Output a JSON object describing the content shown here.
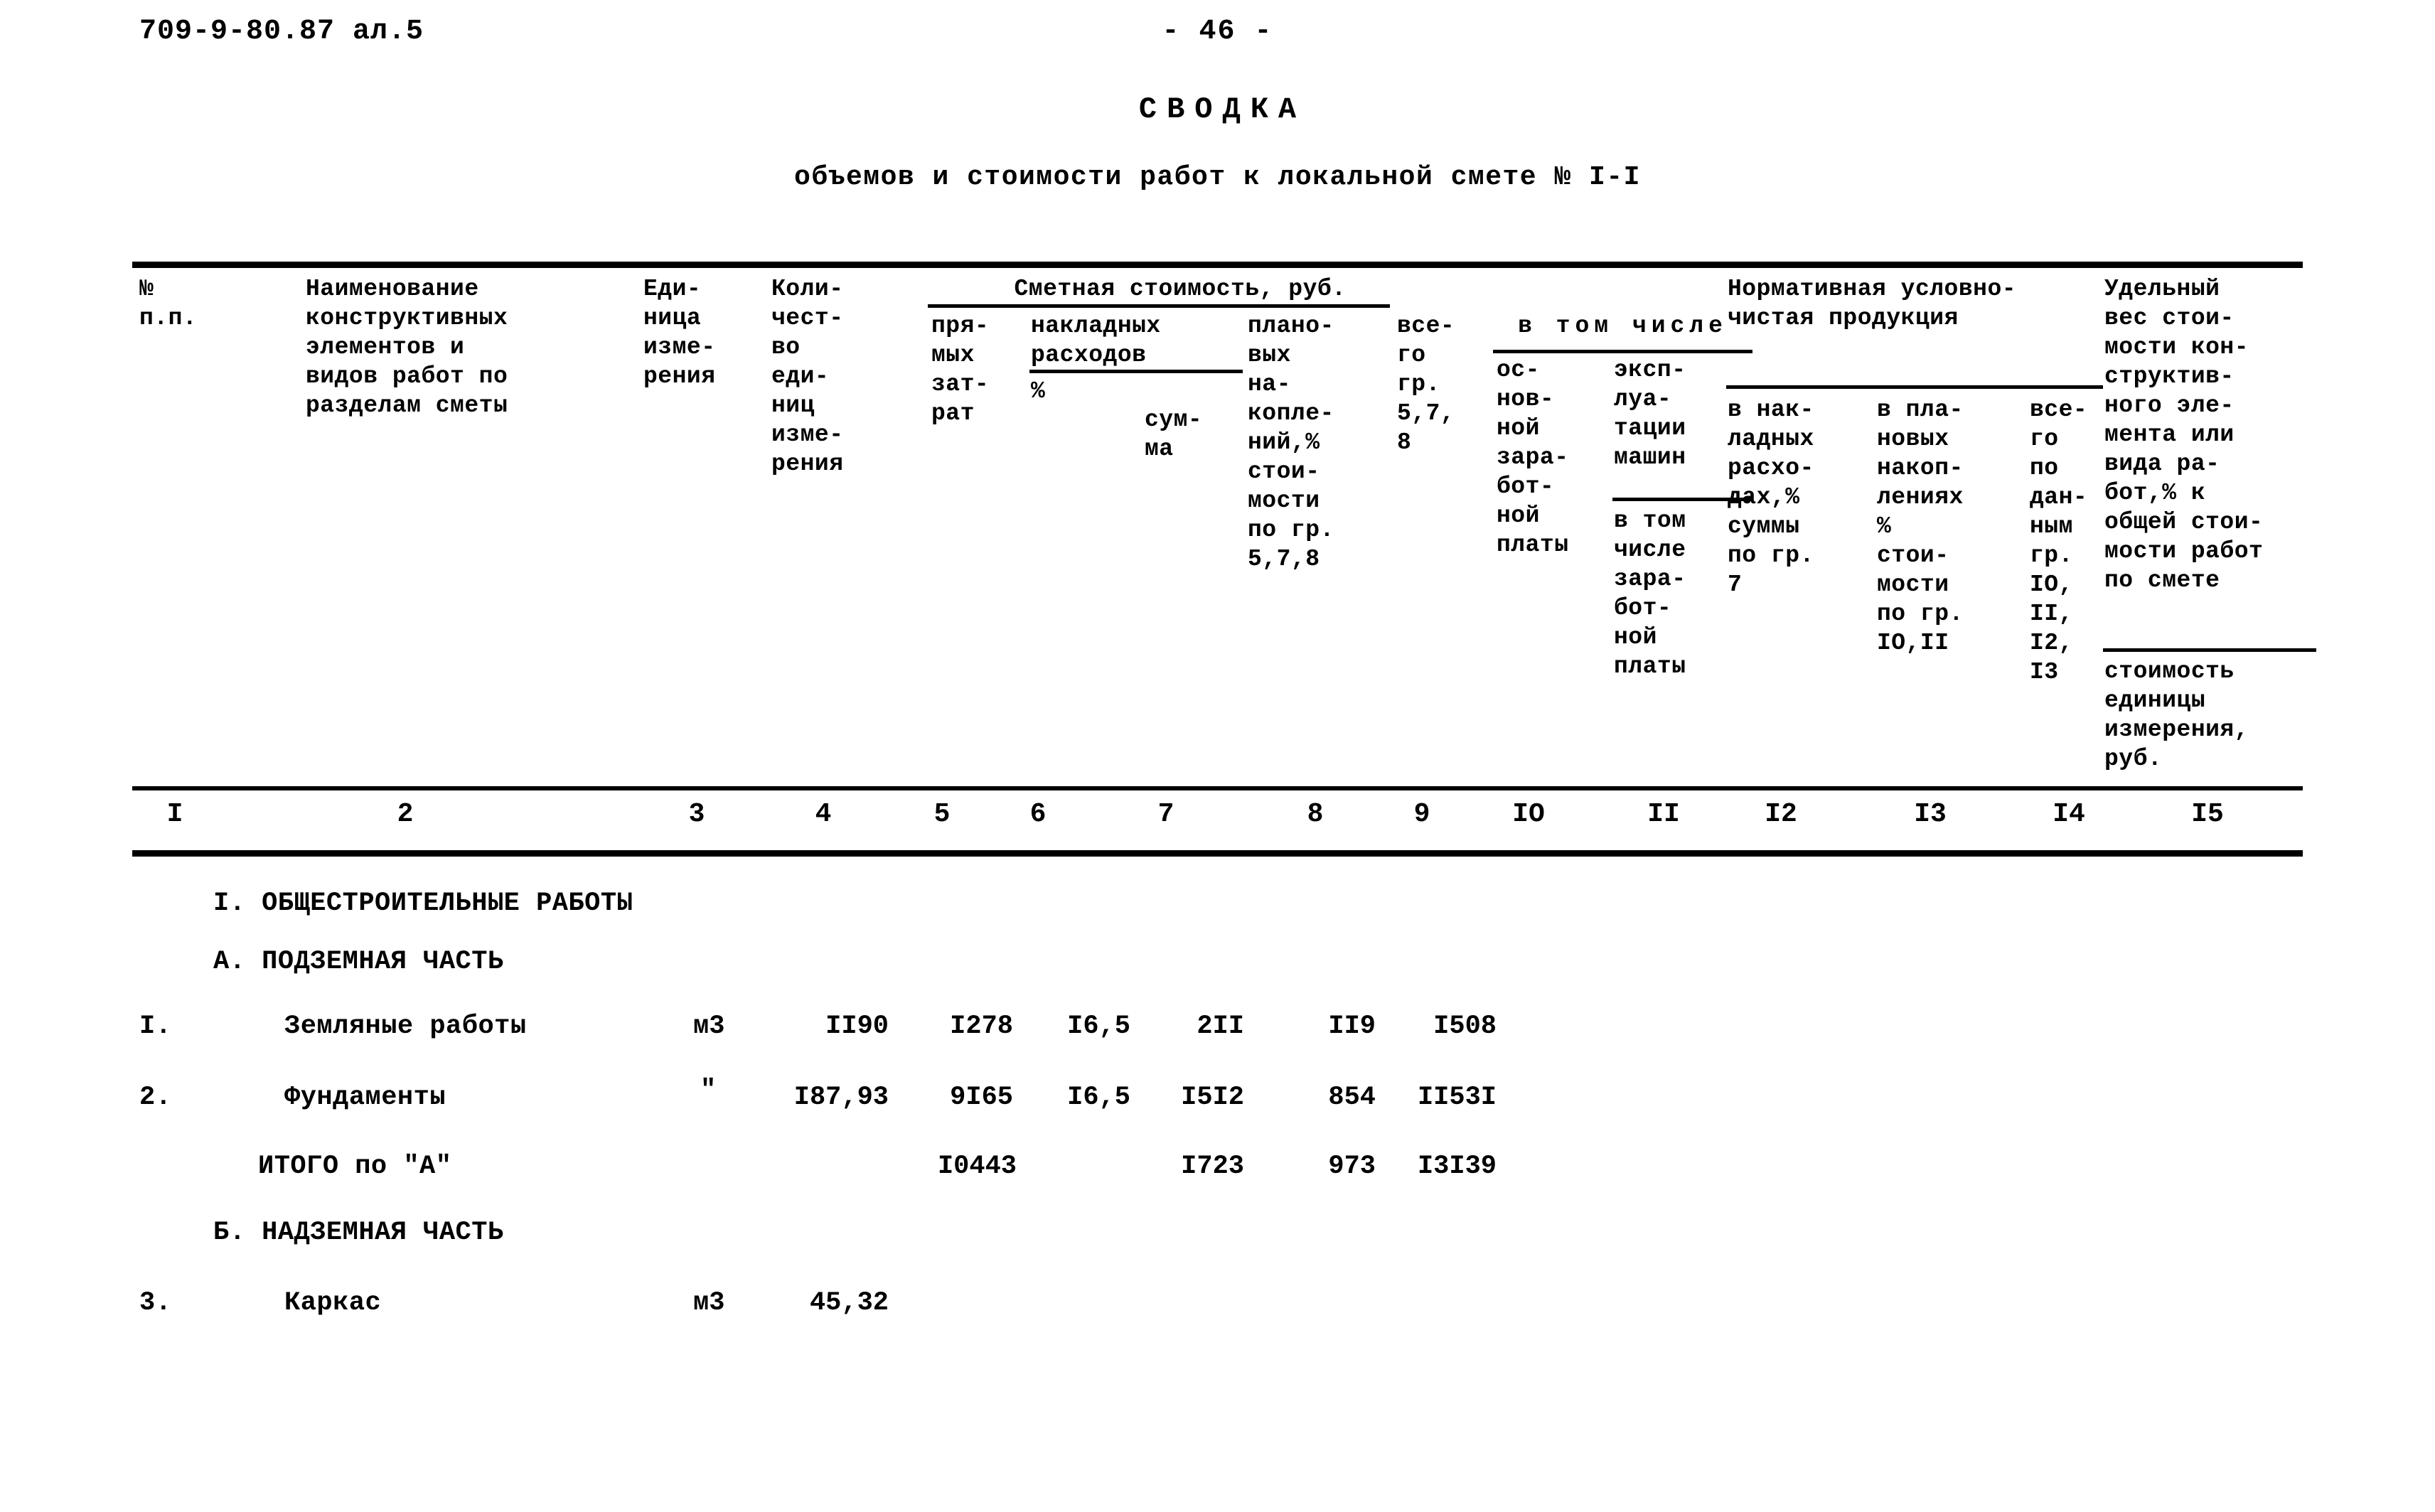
{
  "document": {
    "code": "709-9-80.87 ал.5",
    "page_number": "- 46 -",
    "title": "СВОДКА",
    "subtitle": "объемов и стоимости работ к локальной смете № I-I"
  },
  "table": {
    "group_headers": {
      "smetnaya_stoimost": "Сметная стоимость, руб.",
      "nakladnyh_rashodov": "накладных расходов",
      "v_tom_chisle": "в том числе",
      "normativnaya": "Нормативная условно-чистая продукция"
    },
    "columns": [
      {
        "number": "I",
        "title": "№\nп.п."
      },
      {
        "number": "2",
        "title": "Наименование\nконструктивных\nэлементов и\nвидов работ по\nразделам сметы"
      },
      {
        "number": "3",
        "title": "Еди-\nница\nизме-\nрения"
      },
      {
        "number": "4",
        "title": "Коли-\nчест-\nво\nеди-\nниц\nизме-\nрения"
      },
      {
        "number": "5",
        "title": "пря-\nмых\nзат-\nрат"
      },
      {
        "number": "6",
        "title": "%"
      },
      {
        "number": "7",
        "title": "сум-\nма"
      },
      {
        "number": "8",
        "title": "плано-\nвых\nна-\nкопле-\nний,%\nстои-\nмости\nпо гр.\n5,7,8"
      },
      {
        "number": "9",
        "title": "все-\nго\nгр.\n5,7,\n8"
      },
      {
        "number": "IO",
        "title": "ос-\nнов-\nной\nзара-\nбот-\nной\nплаты"
      },
      {
        "number": "II",
        "title": "экcп-\nлуа-\nтации\nмашин",
        "title2": "в том\nчисле\nзара-\nбот-\nной\nплаты"
      },
      {
        "number": "I2",
        "title": "в нак-\nладных\nрасхо-\nдах,%\nсуммы\nпо гр.\n7"
      },
      {
        "number": "I3",
        "title": "в пла-\nновых\nнакоп-\nлениях\n%\nстои-\nмости\nпо гр.\nIO,II"
      },
      {
        "number": "I4",
        "title": "все-\nго\nпо\nдан-\nным\nгр.\nIO,\nII,\nI2,\nI3"
      },
      {
        "number": "I5",
        "title": "Удельный\nвес стои-\nмости кон-\nструктив-\nного эле-\nмента или\nвида ра-\nбот,% к\nобщей стои-\nмости работ\nпо смете",
        "title2": "стоимость\nединицы\nизмерения,\nруб."
      }
    ],
    "rows": [
      {
        "kind": "section",
        "label": "I. ОБЩЕСТРОИТЕЛЬНЫЕ РАБОТЫ"
      },
      {
        "kind": "section",
        "label": "А. ПОДЗЕМНАЯ ЧАСТЬ"
      },
      {
        "kind": "item",
        "no": "I.",
        "name": "Земляные работы",
        "unit": "м3",
        "qty": "II90",
        "direct": "I278",
        "ovh_pct": "I6,5",
        "ovh_sum": "2II",
        "plan": "II9",
        "total": "I508"
      },
      {
        "kind": "item",
        "no": "2.",
        "name": "Фундаменты",
        "unit": "\"",
        "qty": "I87,93",
        "direct": "9I65",
        "ovh_pct": "I6,5",
        "ovh_sum": "I5I2",
        "plan": "854",
        "total": "II53I"
      },
      {
        "kind": "total",
        "label": "ИТОГО по \"А\"",
        "direct": "I0443",
        "ovh_sum": "I723",
        "plan": "973",
        "total": "I3I39"
      },
      {
        "kind": "section",
        "label": "Б. НАДЗЕМНАЯ ЧАСТЬ"
      },
      {
        "kind": "item",
        "no": "3.",
        "name": "Каркас",
        "unit": "м3",
        "qty": "45,32"
      }
    ]
  }
}
